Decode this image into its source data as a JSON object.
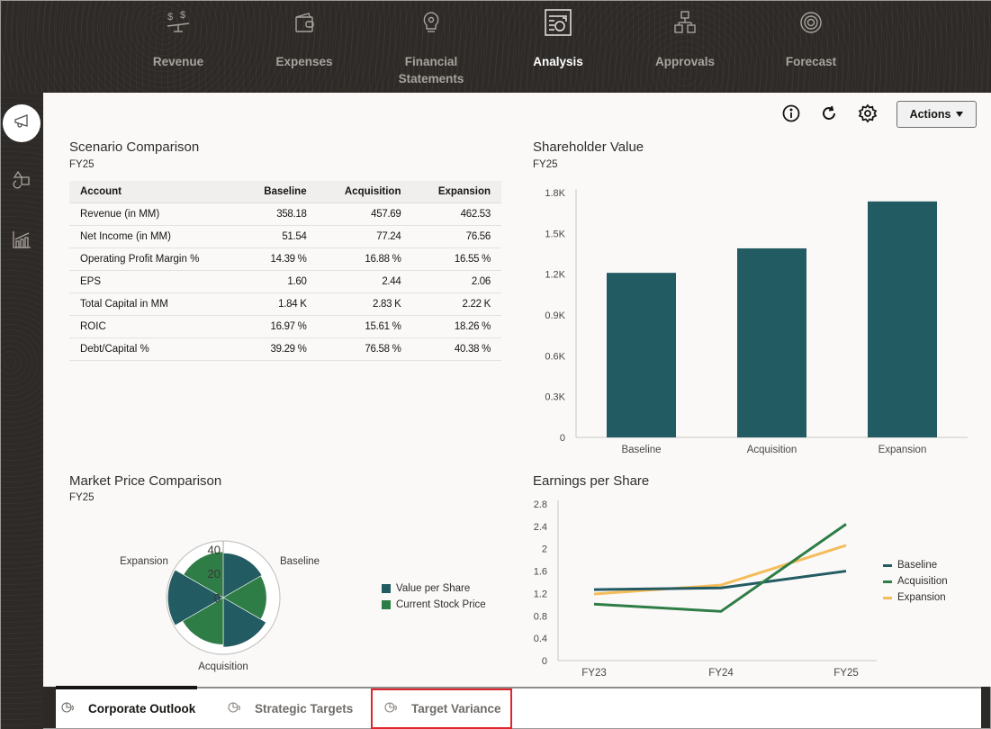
{
  "topnav": {
    "items": [
      {
        "label": "Revenue",
        "icon": "balance-scale-icon",
        "active": false
      },
      {
        "label": "Expenses",
        "icon": "wallet-icon",
        "active": false
      },
      {
        "label": "Financial Statements",
        "icon": "lightbulb-icon",
        "active": false
      },
      {
        "label": "Analysis",
        "icon": "report-chart-icon",
        "active": true
      },
      {
        "label": "Approvals",
        "icon": "hierarchy-icon",
        "active": false
      },
      {
        "label": "Forecast",
        "icon": "target-icon",
        "active": false
      }
    ]
  },
  "sidebar": {
    "items": [
      {
        "icon": "megaphone-icon",
        "active": true
      },
      {
        "icon": "shapes-icon",
        "active": false
      },
      {
        "icon": "bar-chart-icon",
        "active": false
      }
    ]
  },
  "toolbar": {
    "info_icon": "info-icon",
    "refresh_icon": "refresh-icon",
    "settings_icon": "gear-icon",
    "actions_label": "Actions"
  },
  "scenario_comparison": {
    "title": "Scenario Comparison",
    "subtitle": "FY25",
    "columns": [
      "Account",
      "Baseline",
      "Acquisition",
      "Expansion"
    ],
    "rows": [
      [
        "Revenue (in MM)",
        "358.18",
        "457.69",
        "462.53"
      ],
      [
        "Net Income (in MM)",
        "51.54",
        "77.24",
        "76.56"
      ],
      [
        "Operating Profit Margin %",
        "14.39 %",
        "16.88 %",
        "16.55 %"
      ],
      [
        "EPS",
        "1.60",
        "2.44",
        "2.06"
      ],
      [
        "Total Capital in MM",
        "1.84 K",
        "2.83 K",
        "2.22 K"
      ],
      [
        "ROIC",
        "16.97 %",
        "15.61 %",
        "18.26 %"
      ],
      [
        "Debt/Capital %",
        "39.29 %",
        "76.58 %",
        "40.38 %"
      ]
    ]
  },
  "colors": {
    "teal": "#235b63",
    "green": "#2e7d46",
    "orange": "#f5bc5a",
    "highlight_red": "#e0262b"
  },
  "chart_data": [
    {
      "id": "shareholder_value",
      "type": "bar",
      "title": "Shareholder Value",
      "subtitle": "FY25",
      "categories": [
        "Baseline",
        "Acquisition",
        "Expansion"
      ],
      "values": [
        1210,
        1390,
        1735
      ],
      "ylim": [
        0,
        1800
      ],
      "yticks": [
        0,
        300,
        600,
        900,
        1200,
        1500,
        1800
      ],
      "ytick_labels": [
        "0",
        "0.3K",
        "0.6K",
        "0.9K",
        "1.2K",
        "1.5K",
        "1.8K"
      ],
      "xlabel": "",
      "ylabel": "",
      "grid": false
    },
    {
      "id": "market_price_comparison",
      "type": "polar-bar",
      "title": "Market Price Comparison",
      "subtitle": "FY25",
      "categories": [
        "Baseline",
        "Acquisition",
        "Expansion"
      ],
      "series": [
        {
          "name": "Value per Share",
          "values": [
            37,
            41,
            46
          ]
        },
        {
          "name": "Current Stock Price",
          "values": [
            36,
            39,
            38
          ]
        }
      ],
      "rlim": [
        0,
        47
      ],
      "rticks": [
        0,
        20,
        40
      ],
      "legend": "right"
    },
    {
      "id": "earnings_per_share",
      "type": "line",
      "title": "Earnings per Share",
      "x": [
        "FY23",
        "FY24",
        "FY25"
      ],
      "series": [
        {
          "name": "Baseline",
          "values": [
            1.27,
            1.3,
            1.6
          ]
        },
        {
          "name": "Acquisition",
          "values": [
            1.01,
            0.88,
            2.44
          ]
        },
        {
          "name": "Expansion",
          "values": [
            1.19,
            1.35,
            2.06
          ]
        }
      ],
      "ylim": [
        0,
        2.8
      ],
      "yticks": [
        0,
        0.4,
        0.8,
        1.2,
        1.6,
        2,
        2.4,
        2.8
      ],
      "legend": "right",
      "grid": false
    }
  ],
  "bottom_tabs": [
    {
      "label": "Corporate Outlook",
      "icon": "dashboard-icon",
      "active": true,
      "highlighted": false
    },
    {
      "label": "Strategic Targets",
      "icon": "dashboard-icon",
      "active": false,
      "highlighted": false
    },
    {
      "label": "Target Variance",
      "icon": "dashboard-icon",
      "active": false,
      "highlighted": true
    }
  ]
}
